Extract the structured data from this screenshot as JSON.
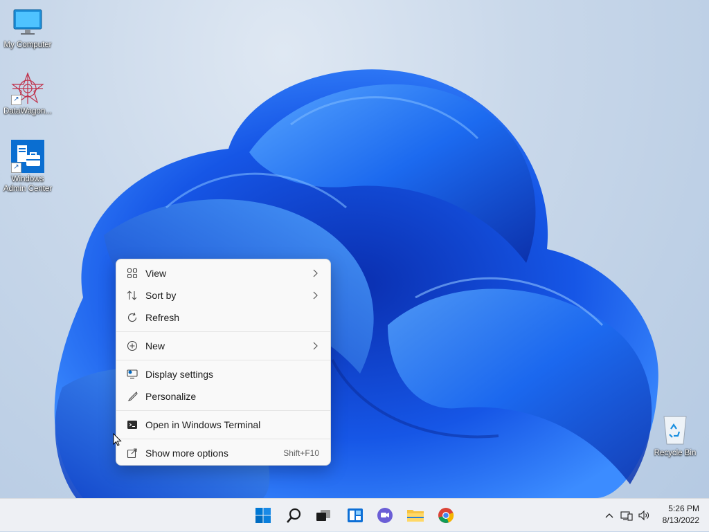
{
  "desktop": {
    "icons": [
      {
        "label": "My Computer"
      },
      {
        "label": "DataWagon..."
      },
      {
        "label_line1": "Windows",
        "label_line2": "Admin Center"
      },
      {
        "label": "Recycle Bin"
      }
    ]
  },
  "context_menu": {
    "items": [
      {
        "label": "View",
        "icon": "view-grid-icon",
        "submenu": true
      },
      {
        "label": "Sort by",
        "icon": "sort-icon",
        "submenu": true
      },
      {
        "label": "Refresh",
        "icon": "refresh-icon"
      },
      {
        "label": "New",
        "icon": "plus-circle-icon",
        "submenu": true
      },
      {
        "label": "Display settings",
        "icon": "display-icon"
      },
      {
        "label": "Personalize",
        "icon": "brush-icon"
      },
      {
        "label": "Open in Windows Terminal",
        "icon": "terminal-icon"
      },
      {
        "label": "Show more options",
        "icon": "more-options-icon",
        "shortcut": "Shift+F10"
      }
    ]
  },
  "taskbar": {
    "apps": [
      "start-icon",
      "search-icon",
      "task-view-icon",
      "widgets-icon",
      "teams-chat-icon",
      "file-explorer-icon",
      "chrome-icon"
    ],
    "clock": {
      "time": "5:26 PM",
      "date": "8/13/2022"
    }
  },
  "colors": {
    "accent": "#0067c0",
    "menu_bg": "#f9f9f9",
    "taskbar_bg": "#eef0f4"
  }
}
